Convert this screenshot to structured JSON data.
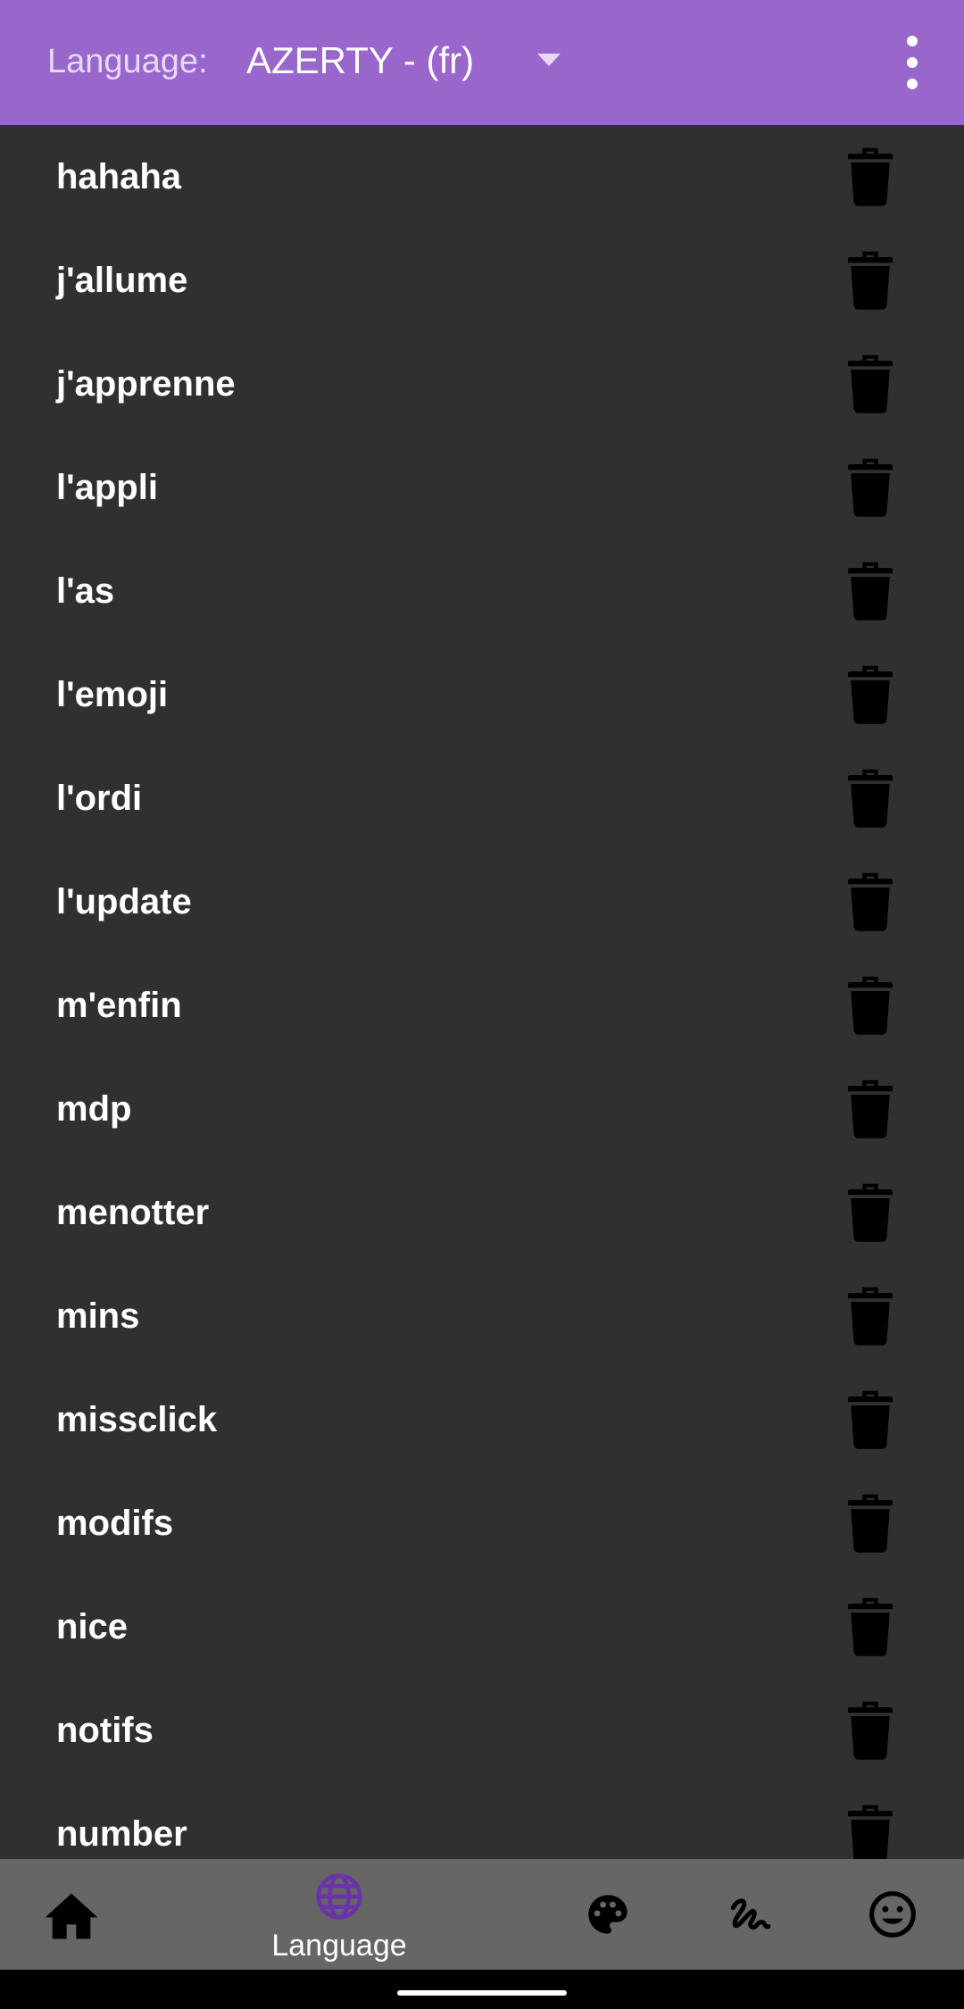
{
  "header": {
    "language_label": "Language:",
    "language_value": "AZERTY - (fr)"
  },
  "words": [
    "hahaha",
    "j'allume",
    "j'apprenne",
    "l'appli",
    "l'as",
    "l'emoji",
    "l'ordi",
    "l'update",
    "m'enfin",
    "mdp",
    "menotter",
    "mins",
    "missclick",
    "modifs",
    "nice",
    "notifs",
    "number"
  ],
  "bottom_nav": {
    "items": [
      {
        "icon": "home-icon",
        "label": ""
      },
      {
        "icon": "globe-icon",
        "label": "Language",
        "active": true
      },
      {
        "icon": "palette-icon",
        "label": ""
      },
      {
        "icon": "gesture-icon",
        "label": ""
      },
      {
        "icon": "emoji-icon",
        "label": ""
      }
    ]
  },
  "colors": {
    "topbar": "#9966cc",
    "background": "#303030",
    "bottom_nav": "#666666",
    "active_icon": "#6a33a8"
  }
}
